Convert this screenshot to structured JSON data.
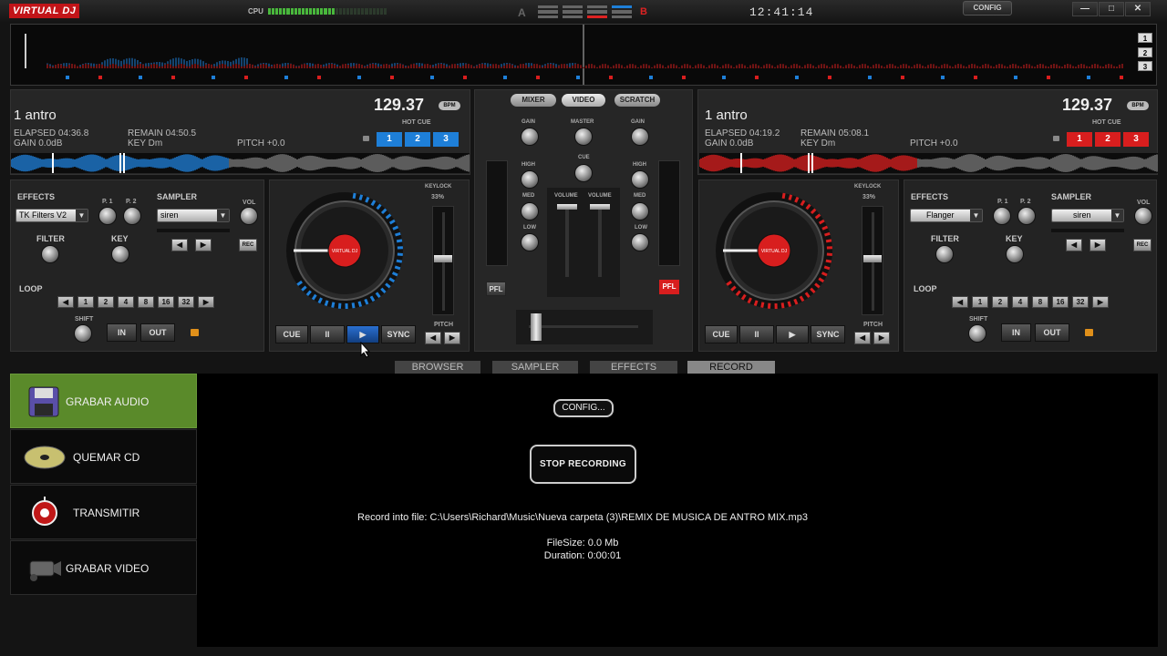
{
  "app": {
    "logo": "VIRTUAL DJ",
    "cpu_label": "CPU",
    "cpu_load": 0.55,
    "clock": "12:41:14",
    "config": "CONFIG",
    "win_min": "—",
    "win_max": "□",
    "win_close": "✕",
    "deck_a": "A",
    "deck_b": "B"
  },
  "zoom": [
    "1",
    "2",
    "3"
  ],
  "deck_left": {
    "title": "1 antro",
    "bpm": "129.37",
    "bpm_unit": "BPM",
    "elapsed": "ELAPSED 04:36.8",
    "remain": "REMAIN 04:50.5",
    "gain": "GAIN 0.0dB",
    "key": "KEY Dm",
    "pitch": "PITCH +0.0",
    "hot_cue_label": "HOT CUE",
    "hot_cues": [
      "1",
      "2",
      "3"
    ],
    "accent": "#1e7fd8",
    "effects_label": "EFFECTS",
    "effect": "TK Filters V2",
    "p1": "P. 1",
    "p2": "P. 2",
    "sampler_label": "SAMPLER",
    "sample": "siren",
    "vol": "VOL",
    "rec": "REC",
    "filter": "FILTER",
    "key_label": "KEY",
    "loop": "LOOP",
    "loop_values": [
      "1",
      "2",
      "4",
      "8",
      "16",
      "32"
    ],
    "shift": "SHIFT",
    "in": "IN",
    "out": "OUT",
    "keylock": "KEYLOCK",
    "keylock_pct": "33%",
    "cue": "CUE",
    "pause": "II",
    "play": "▶",
    "sync": "SYNC",
    "pitch_label": "PITCH",
    "platter_label": "VIRTUAL DJ"
  },
  "deck_right": {
    "title": "1 antro",
    "bpm": "129.37",
    "bpm_unit": "BPM",
    "elapsed": "ELAPSED 04:19.2",
    "remain": "REMAIN 05:08.1",
    "gain": "GAIN 0.0dB",
    "key": "KEY Dm",
    "pitch": "PITCH +0.0",
    "hot_cue_label": "HOT CUE",
    "hot_cues": [
      "1",
      "2",
      "3"
    ],
    "accent": "#d81e1e",
    "effects_label": "EFFECTS",
    "effect": "Flanger",
    "p1": "P. 1",
    "p2": "P. 2",
    "sampler_label": "SAMPLER",
    "sample": "siren",
    "vol": "VOL",
    "rec": "REC",
    "filter": "FILTER",
    "key_label": "KEY",
    "loop": "LOOP",
    "loop_values": [
      "1",
      "2",
      "4",
      "8",
      "16",
      "32"
    ],
    "shift": "SHIFT",
    "in": "IN",
    "out": "OUT",
    "keylock": "KEYLOCK",
    "keylock_pct": "33%",
    "cue": "CUE",
    "pause": "II",
    "play": "▶",
    "sync": "SYNC",
    "pitch_label": "PITCH",
    "platter_label": "VIRTUAL DJ"
  },
  "mixer": {
    "tabs": [
      "MIXER",
      "VIDEO",
      "SCRATCH"
    ],
    "gain": "GAIN",
    "master": "MASTER",
    "cue": "CUE",
    "high": "HIGH",
    "med": "MED",
    "low": "LOW",
    "volume": "VOLUME",
    "pfl": "PFL"
  },
  "bottom_tabs": [
    "BROWSER",
    "SAMPLER",
    "EFFECTS",
    "RECORD"
  ],
  "sidebar": [
    "GRABAR AUDIO",
    "QUEMAR CD",
    "TRANSMITIR",
    "GRABAR VIDEO"
  ],
  "record": {
    "config": "CONFIG...",
    "stop": "STOP RECORDING",
    "file": "Record into file: C:\\Users\\Richard\\Music\\Nueva carpeta (3)\\REMIX DE MUSICA DE ANTRO MIX.mp3",
    "filesize": "FileSize: 0.0 Mb",
    "duration": "Duration: 0:00:01"
  }
}
